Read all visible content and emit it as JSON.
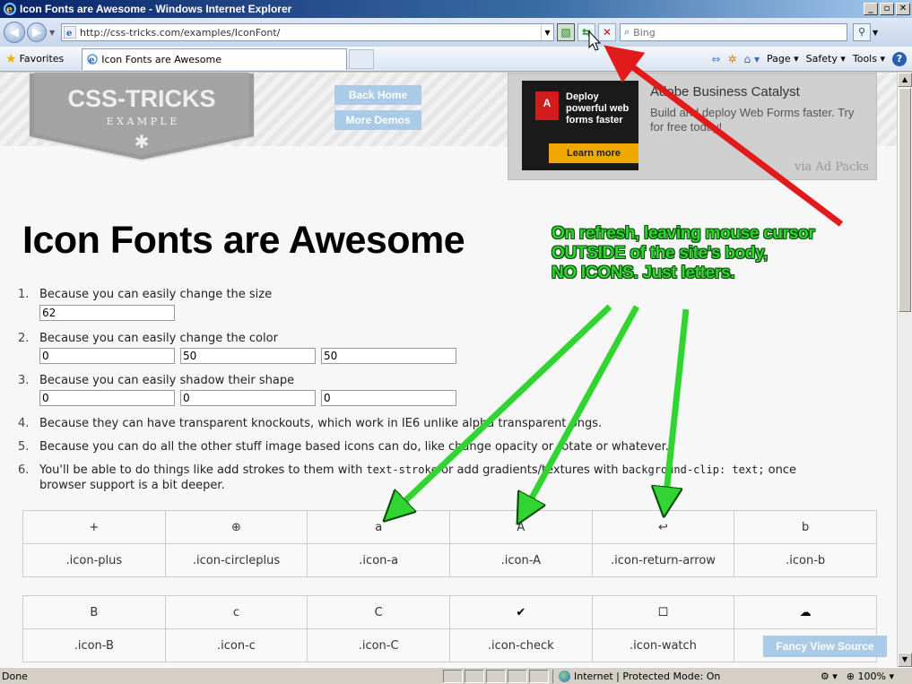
{
  "window": {
    "title": "Icon Fonts are Awesome - Windows Internet Explorer",
    "min_label": "_",
    "max_label": "▫",
    "close_label": "✕"
  },
  "addressbar": {
    "url": "http://css-tricks.com/examples/IconFont/",
    "search_placeholder": "Bing"
  },
  "favbar": {
    "favorites_label": "Favorites",
    "tab_title": "Icon Fonts are Awesome",
    "commands": [
      "Page ▾",
      "Safety ▾",
      "Tools ▾"
    ]
  },
  "site": {
    "logo_main": "CSS-TRICKS",
    "logo_sub": "E X A M P L E",
    "back_home": "Back Home",
    "more_demos": "More Demos",
    "ad": {
      "small_text": "Deploy powerful web forms faster",
      "learn_more": "Learn more",
      "title": "Adobe Business Catalyst",
      "desc": "Build and deploy Web Forms faster. Try for free today!",
      "via": "via Ad Packs"
    },
    "page_title": "Icon Fonts are Awesome",
    "list": [
      {
        "num": "1.",
        "text": "Because you can easily change the size",
        "inputs": [
          "62"
        ]
      },
      {
        "num": "2.",
        "text": "Because you can easily change the color",
        "inputs": [
          "0",
          "50",
          "50"
        ]
      },
      {
        "num": "3.",
        "text": "Because you can easily shadow their shape",
        "inputs": [
          "0",
          "0",
          "0"
        ]
      },
      {
        "num": "4.",
        "text": "Because they can have transparent knockouts, which work in IE6 unlike alpha transparent pngs."
      },
      {
        "num": "5.",
        "text": "Because you can do all the other stuff image based icons can do, like change opacity or rotate or whatever."
      },
      {
        "num": "6.",
        "text_a": "You'll be able to do things like add strokes to them with ",
        "code_a": "text-stroke",
        "text_b": " or add gradients/textures with ",
        "code_b": "background-clip: text;",
        "text_c": " once",
        "text_d": "browser support is a bit deeper."
      }
    ],
    "table1": {
      "glyphs": [
        "+",
        "⊕",
        "a",
        "A",
        "↩",
        "b"
      ],
      "names": [
        ".icon-plus",
        ".icon-circleplus",
        ".icon-a",
        ".icon-A",
        ".icon-return-arrow",
        ".icon-b"
      ]
    },
    "table2": {
      "glyphs": [
        "B",
        "c",
        "C",
        "✔",
        "☐",
        "☁"
      ],
      "names": [
        ".icon-B",
        ".icon-c",
        ".icon-C",
        ".icon-check",
        ".icon-watch",
        ""
      ]
    },
    "fancy_view": "Fancy View Source"
  },
  "annotation": {
    "line1": "On refresh, leaving mouse cursor",
    "line2": "OUTSIDE of the site's body,",
    "line3": "NO ICONS. Just letters."
  },
  "statusbar": {
    "status": "Done",
    "zone": "Internet | Protected Mode: On",
    "zoom": "100%"
  },
  "colors": {
    "annotation_green": "#31d431",
    "arrow_red": "#e11b1b",
    "button_blue": "#a9cbe8"
  }
}
